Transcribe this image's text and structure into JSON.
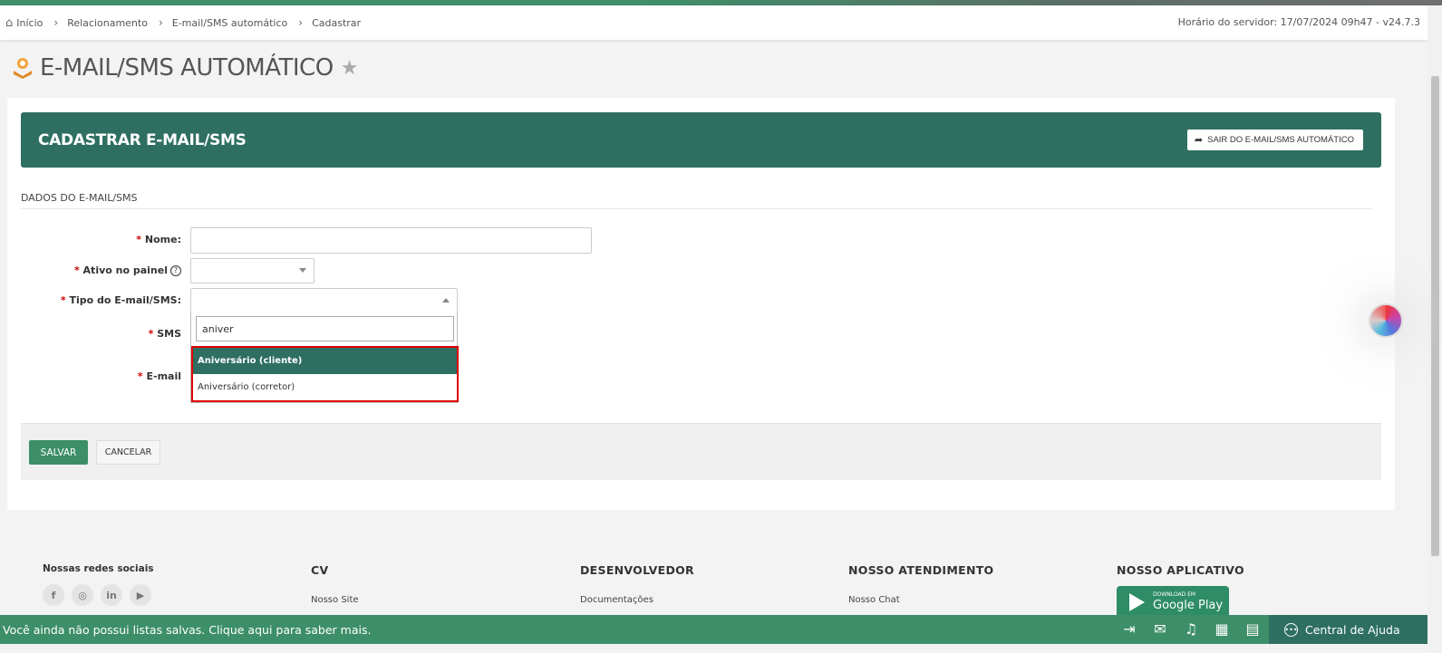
{
  "breadcrumb": {
    "items": [
      "Início",
      "Relacionamento",
      "E-mail/SMS automático",
      "Cadastrar"
    ]
  },
  "server": {
    "text": "Horário do servidor: 17/07/2024 09h47 - v24.7.3"
  },
  "page": {
    "title": "E-MAIL/SMS AUTOMÁTICO"
  },
  "card": {
    "title": "CADASTRAR E-MAIL/SMS",
    "exit_label": "SAIR DO E-MAIL/SMS AUTOMÁTICO",
    "section": "DADOS DO E-MAIL/SMS"
  },
  "form": {
    "nome_label": "Nome:",
    "ativo_label": "Ativo no painel",
    "tipo_label": "Tipo do E-mail/SMS:",
    "sms_label": "SMS",
    "email_label": "E-mail",
    "required_mark": "*",
    "help_glyph": "?"
  },
  "dropdown": {
    "search_value": "aniver",
    "options": [
      "Aniversário (cliente)",
      "Aniversário (corretor)"
    ],
    "selected_index": 0
  },
  "actions": {
    "save": "SALVAR",
    "cancel": "CANCELAR"
  },
  "footer": {
    "social_title": "Nossas redes sociais",
    "socials": [
      "f",
      "◎",
      "in",
      "▶"
    ],
    "cols": [
      {
        "title": "CV",
        "link": "Nosso Site"
      },
      {
        "title": "DESENVOLVEDOR",
        "link": "Documentações"
      },
      {
        "title": "NOSSO ATENDIMENTO",
        "link": "Nosso Chat"
      },
      {
        "title": "NOSSO APLICATIVO",
        "link": ""
      }
    ],
    "gplay_small": "DOWNLOAD EM",
    "gplay_big": "Google Play"
  },
  "bottom": {
    "message": "Você ainda não possui listas salvas. Clique aqui para saber mais.",
    "help": "Central de Ajuda",
    "icons": [
      "collapse-icon",
      "mail-icon",
      "bell-icon",
      "calendar-icon",
      "calculator-icon"
    ]
  },
  "colors": {
    "primary": "#2e6f62",
    "accent": "#3d8f69",
    "highlight_border": "#e00000"
  }
}
